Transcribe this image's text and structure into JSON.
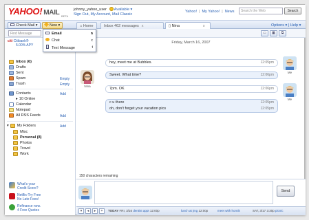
{
  "header": {
    "logo": "YAHOO!",
    "logo_mail": "MAIL",
    "beta": "BETA",
    "username": "johnny_yahoo_user",
    "status": "Available ▾",
    "account_links": "Sign Out, My Account, Mail Classic",
    "top_links": [
      "Yahoo!",
      "My Yahoo!",
      "News"
    ],
    "search_placeholder": "Search the Web",
    "search_button": "Search"
  },
  "toolbar": {
    "check_mail": "Check Mail ▾",
    "new": "New ▾",
    "options": "Options ▾ | Help ▾",
    "find_placeholder": "Find Message",
    "new_menu": [
      {
        "label": "Email",
        "key": "n"
      },
      {
        "label": "Chat",
        "key": "c"
      },
      {
        "label": "Text Message",
        "key": "t"
      }
    ]
  },
  "tabs": [
    {
      "label": "Home"
    },
    {
      "label": "Inbox 462 messages"
    },
    {
      "label": "Nina"
    }
  ],
  "sidebar": {
    "ad_line1": "Citibank®",
    "ad_line2": "5.00% APY",
    "folders": [
      {
        "label": "Inbox",
        "count": "(6)",
        "action": ""
      },
      {
        "label": "Drafts",
        "count": "",
        "action": ""
      },
      {
        "label": "Sent",
        "count": "",
        "action": ""
      },
      {
        "label": "Spam",
        "count": "",
        "action": "Empty"
      },
      {
        "label": "Trash",
        "count": "",
        "action": "Empty"
      }
    ],
    "contacts": {
      "label": "Contacts",
      "action": "Add",
      "online": "10 Online"
    },
    "calendar": "Calendar",
    "notepad": "Notepad",
    "rss": {
      "label": "All RSS Feeds",
      "action": "Add"
    },
    "my_folders": {
      "label": "My Folders",
      "action": "Add"
    },
    "sub_folders": [
      {
        "label": "Misc",
        "count": ""
      },
      {
        "label": "Personal",
        "count": "(8)"
      },
      {
        "label": "Photos",
        "count": ""
      },
      {
        "label": "Travel",
        "count": ""
      },
      {
        "label": "Work",
        "count": ""
      }
    ],
    "promos": [
      {
        "line1": "What's your",
        "line2": "Credit Score?"
      },
      {
        "line1": "Netflix-Try Free",
        "line2": "No Late Fees!"
      },
      {
        "line1": "Refinance now.",
        "line2": "4 Free Quotes"
      }
    ]
  },
  "chat": {
    "date": "Friday, March 16, 2007",
    "me_label": "Me",
    "nina_label": "Nina",
    "messages": [
      {
        "from": "me",
        "text": "hey, meet me at Bubbles.",
        "time": "12:05pm"
      },
      {
        "from": "nina",
        "text": "Sweet. What time?",
        "time": "12:06pm"
      },
      {
        "from": "me",
        "text": "7pm. OK",
        "time": "12:06pm"
      },
      {
        "from": "nina",
        "text": "c u there",
        "time": "12:05pm"
      },
      {
        "from": "nina",
        "text": "oh, don't forget your vacation pics",
        "time": "12:05pm"
      }
    ],
    "remaining": "150 characters remaining",
    "send": "Send"
  },
  "bottombar": {
    "today": "TODAY",
    "events": [
      {
        "date": "FRI, 3/16",
        "title": "dentist appt",
        "time": "12:00p"
      },
      {
        "date": "",
        "title": "lunch at jmg",
        "time": "12:00p"
      },
      {
        "date": "",
        "title": "meet with hornik",
        "time": ""
      },
      {
        "date": "SAT, 3/17",
        "title": "picnic",
        "time": "3:30p"
      }
    ],
    "extra_time": "12:00p"
  },
  "colors": {
    "brand_red": "#d11111",
    "link_blue": "#2a61b4",
    "chat_bubble": "#eaf1fb"
  }
}
